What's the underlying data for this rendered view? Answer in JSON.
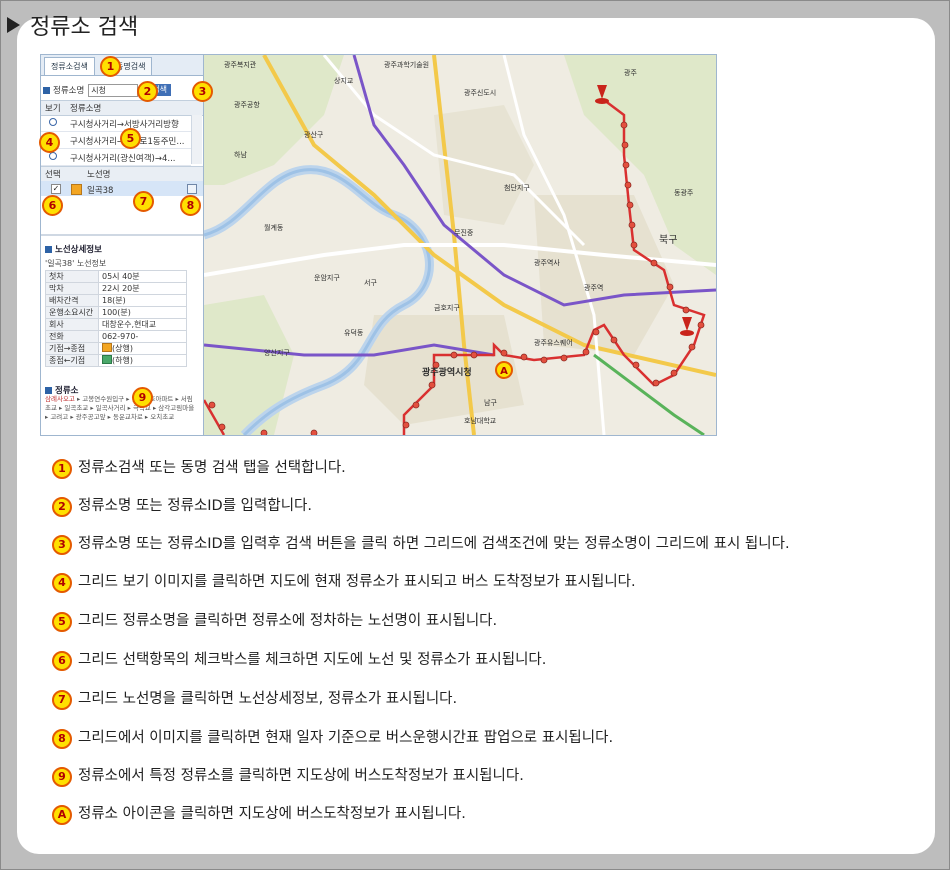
{
  "page_title": "정류소 검색",
  "screenshot": {
    "tabs": [
      "정류소검색",
      "동명검색"
    ],
    "search": {
      "label": "정류소명",
      "value": "시청",
      "button": "검색"
    },
    "grid": {
      "headers": [
        "보기",
        "정류소명"
      ],
      "rows": [
        "구시청사거리→서방사거리방향",
        "구시청사거리→금남로1동주민...",
        "구시청사거리(광신여객)→4..."
      ]
    },
    "route_grid": {
      "headers": [
        "선택",
        "노선명"
      ],
      "rows": [
        {
          "checked": "✓",
          "name": "일곡38"
        }
      ]
    },
    "route_detail": {
      "title": "노선상세정보",
      "subtitle": "'일곡38' 노선정보",
      "rows": [
        {
          "k": "첫차",
          "v": "05시 40분"
        },
        {
          "k": "막차",
          "v": "22시 20분"
        },
        {
          "k": "배차간격",
          "v": "18(분)"
        },
        {
          "k": "운행소요시간",
          "v": "100(분)"
        },
        {
          "k": "회사",
          "v": "대창운수,현대교"
        },
        {
          "k": "전화",
          "v": "062-970-"
        },
        {
          "k": "기점→종점",
          "v": "(상행)"
        },
        {
          "k": "종점←기점",
          "v": "(하행)"
        }
      ]
    },
    "stops": {
      "title": "정류소",
      "first": "삼례사오고",
      "rest": " ▸ 고봉연수원입구 ▸ 일곡삼호아파트 ▸ 서림초교 ▸ 일곡초교 ▸ 일곡사거리 ▸ 극락교 ▸ 삼각고림마을 ▸ 고려고 ▸ 광주공고앞 ▸ 동운교차로 ▸ 오치초교"
    },
    "map": {
      "labels": [
        "광주복지관",
        "광주과학기술원",
        "상지교",
        "광주공항",
        "광주신도시",
        "광산구",
        "하남",
        "광주",
        "북구",
        "동광주",
        "광주역",
        "서구",
        "광주광역시청",
        "광주유스퀘어",
        "무진중",
        "남구",
        "월계동",
        "첨단지구",
        "호남대학교",
        "광주역사",
        "금호지구",
        "양산지구",
        "운암지구",
        "유덕동"
      ],
      "marker": "A"
    }
  },
  "badges": {
    "b1": "1",
    "b2": "2",
    "b3": "3",
    "b4": "4",
    "b5": "5",
    "b6": "6",
    "b7": "7",
    "b8": "8",
    "b9": "9"
  },
  "instructions": [
    {
      "num": "1",
      "text": "정류소검색 또는 동명 검색 탭을 선택합니다."
    },
    {
      "num": "2",
      "text": "정류소명 또는 정류소ID를 입력합니다."
    },
    {
      "num": "3",
      "text": "정류소명 또는 정류소ID를 입력후 검색 버튼을 클릭 하면 그리드에 검색조건에 맞는 정류소명이 그리드에 표시 됩니다."
    },
    {
      "num": "4",
      "text": "그리드 보기 이미지를 클릭하면 지도에 현재 정류소가 표시되고 버스 도착정보가 표시됩니다."
    },
    {
      "num": "5",
      "text": "그리드 정류소명을 클릭하면 정류소에 정차하는 노선명이 표시됩니다."
    },
    {
      "num": "6",
      "text": "그리드 선택항목의 체크박스를 체크하면 지도에 노선 및 정류소가 표시됩니다."
    },
    {
      "num": "7",
      "text": "그리드 노선명을 클릭하면 노선상세정보, 정류소가 표시됩니다."
    },
    {
      "num": "8",
      "text": "그리드에서 이미지를 클릭하면 현재 일자 기준으로 버스운행시간표 팝업으로 표시됩니다."
    },
    {
      "num": "9",
      "text": "정류소에서 특정 정류소를 클릭하면 지도상에 버스도착정보가 표시됩니다."
    },
    {
      "num": "A",
      "text": "정류소 아이콘을 클릭하면 지도상에 버스도착정보가 표시됩니다."
    }
  ],
  "colors": {
    "badge_fill": "#ffe000",
    "badge_border": "#e45a00",
    "route": "#d93030",
    "rail": "#7a55c8"
  }
}
